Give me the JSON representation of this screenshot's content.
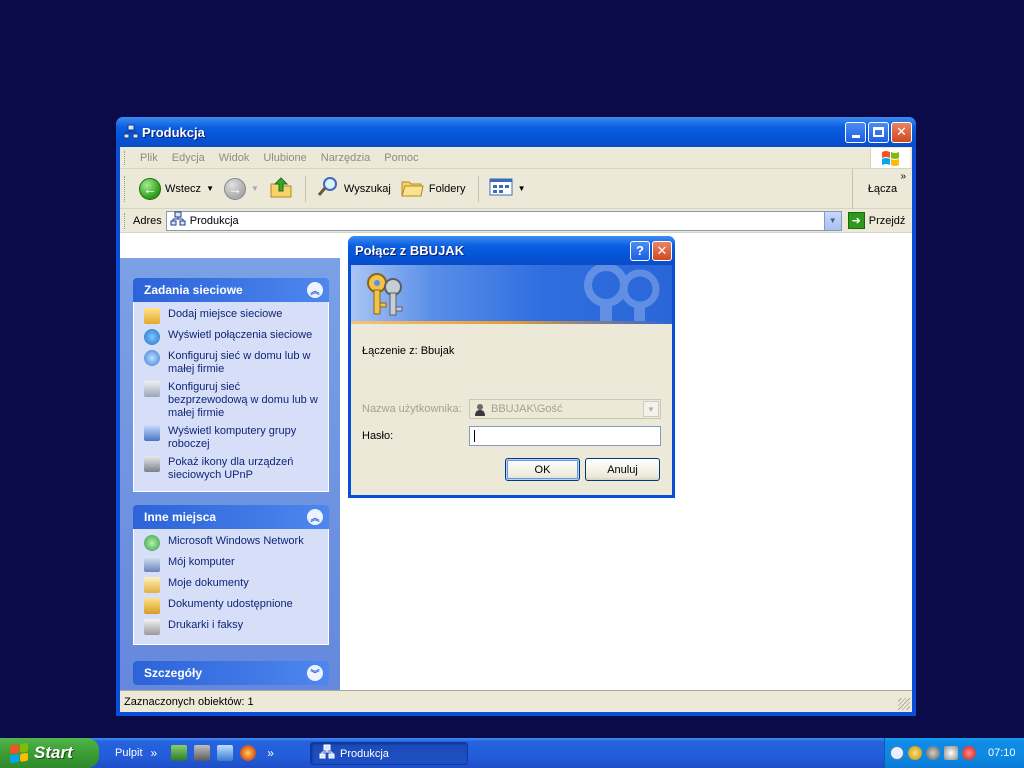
{
  "window": {
    "title": "Produkcja",
    "menu": [
      "Plik",
      "Edycja",
      "Widok",
      "Ulubione",
      "Narzędzia",
      "Pomoc"
    ],
    "toolbar": {
      "back_label": "Wstecz",
      "search_label": "Wyszukaj",
      "folders_label": "Foldery",
      "links_label": "Łącza",
      "links_chevron": "»"
    },
    "address": {
      "label": "Adres",
      "value": "Produkcja",
      "go_label": "Przejdź"
    },
    "status_text": "Zaznaczonych obiektów: 1"
  },
  "taskpane": {
    "network_tasks": {
      "title": "Zadania sieciowe",
      "items": [
        "Dodaj miejsce sieciowe",
        "Wyświetl połączenia sieciowe",
        "Konfiguruj sieć w domu lub w małej firmie",
        "Konfiguruj sieć bezprzewodową w domu lub w małej firmie",
        "Wyświetl komputery grupy roboczej",
        "Pokaż ikony dla urządzeń sieciowych UPnP"
      ]
    },
    "other_places": {
      "title": "Inne miejsca",
      "items": [
        "Microsoft Windows Network",
        "Mój komputer",
        "Moje dokumenty",
        "Dokumenty udostępnione",
        "Drukarki i faksy"
      ]
    },
    "details": {
      "title": "Szczegóły"
    }
  },
  "dialog": {
    "title": "Połącz z BBUJAK",
    "help_glyph": "?",
    "close_glyph": "✕",
    "connecting_text": "Łączenie z: Bbujak",
    "username_label": "Nazwa użytkownika:",
    "username_value": "BBUJAK\\Gość",
    "password_label": "Hasło:",
    "ok_label": "OK",
    "cancel_label": "Anuluj"
  },
  "taskbar": {
    "start_label": "Start",
    "desktop_label": "Pulpit",
    "chevron": "»",
    "task_label": "Produkcja",
    "clock": "07:10"
  },
  "colors": {
    "desktop": "#0a0b48",
    "xp_blue": "#0554d8",
    "task_pane": "#6d92e0",
    "start_green": "#3c9d34"
  }
}
